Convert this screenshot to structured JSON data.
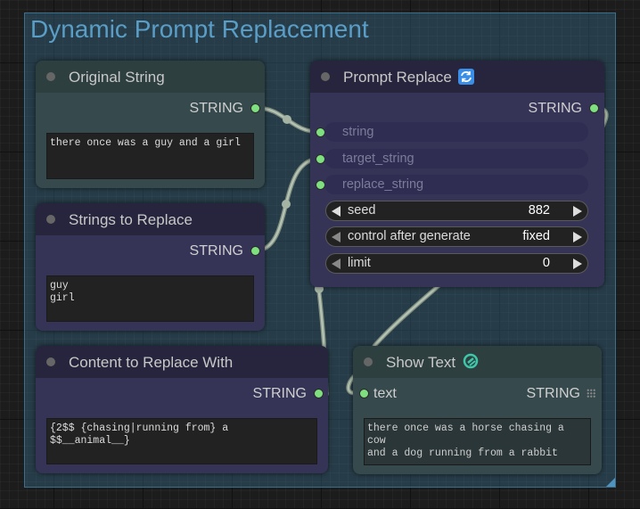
{
  "group": {
    "title": "Dynamic Prompt Replacement"
  },
  "nodes": {
    "original_string": {
      "title": "Original String",
      "output_label": "STRING",
      "text": "there once was a guy and a girl"
    },
    "strings_to_replace": {
      "title": "Strings to Replace",
      "output_label": "STRING",
      "text": "guy\ngirl"
    },
    "content_to_replace": {
      "title": "Content to Replace With",
      "output_label": "STRING",
      "text": "{2$$ {chasing|running from} a $$__animal__}"
    },
    "prompt_replace": {
      "title": "Prompt Replace",
      "title_icon": "refresh-badge-icon",
      "output_label": "STRING",
      "inputs": [
        "string",
        "target_string",
        "replace_string"
      ],
      "widgets": {
        "seed": {
          "label": "seed",
          "value": "882"
        },
        "control": {
          "label": "control after generate",
          "value": "fixed"
        },
        "limit": {
          "label": "limit",
          "value": "0"
        }
      }
    },
    "show_text": {
      "title": "Show Text",
      "title_icon": "link-badge-icon",
      "input_label": "text",
      "output_label": "STRING",
      "text": "there once was a horse chasing a cow\nand a dog running from a rabbit"
    }
  },
  "colors": {
    "group_bg": "#386e8c",
    "group_title": "#5a9dc6",
    "string_node_body": "#364a4d",
    "string_node_header": "#2e3f40",
    "dark_node_body": "#353457",
    "dark_node_header": "#26253d",
    "slot_green": "#7fe07f",
    "wire": "#a4b3a4"
  }
}
